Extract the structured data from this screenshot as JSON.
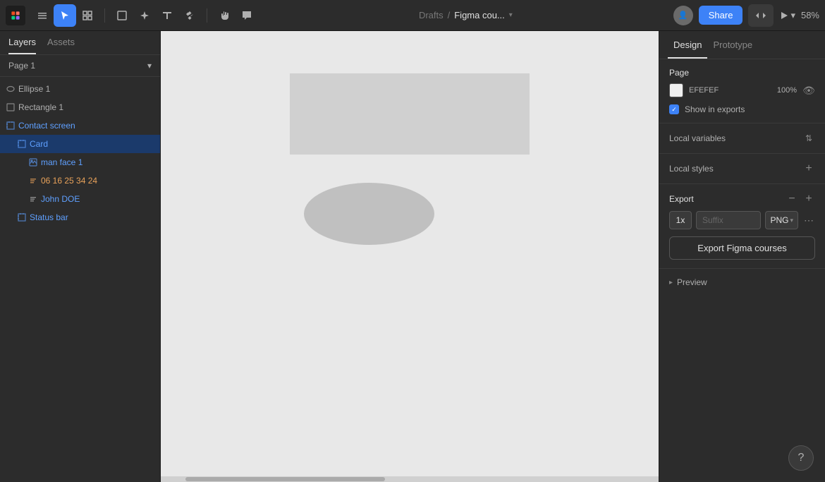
{
  "toolbar": {
    "logo_label": "Figma",
    "breadcrumb_prefix": "Drafts",
    "breadcrumb_separator": "/",
    "breadcrumb_title": "Figma cou...",
    "share_label": "Share",
    "zoom_label": "58%"
  },
  "left_panel": {
    "tab_layers": "Layers",
    "tab_assets": "Assets",
    "page_label": "Page 1",
    "layers": [
      {
        "id": "ellipse1",
        "label": "Ellipse 1",
        "type": "ellipse",
        "indent": 0
      },
      {
        "id": "rectangle1",
        "label": "Rectangle 1",
        "type": "rectangle",
        "indent": 0
      },
      {
        "id": "contact-screen",
        "label": "Contact screen",
        "type": "frame",
        "indent": 0,
        "selected": false
      },
      {
        "id": "card",
        "label": "Card",
        "type": "frame",
        "indent": 1,
        "selected": true
      },
      {
        "id": "man-face-1",
        "label": "man face 1",
        "type": "image",
        "indent": 2
      },
      {
        "id": "phone-number",
        "label": "06 16 25 34 24",
        "type": "text-orange",
        "indent": 2
      },
      {
        "id": "john-doe",
        "label": "John DOE",
        "type": "text-blue",
        "indent": 2
      },
      {
        "id": "status-bar",
        "label": "Status bar",
        "type": "frame",
        "indent": 1
      }
    ]
  },
  "right_panel": {
    "tab_design": "Design",
    "tab_prototype": "Prototype",
    "page_section_title": "Page",
    "page_color_value": "EFEFEF",
    "page_opacity_value": "100%",
    "show_in_exports_label": "Show in exports",
    "local_variables_label": "Local variables",
    "local_styles_label": "Local styles",
    "export_title": "Export",
    "export_scale": "1x",
    "export_suffix_placeholder": "Suffix",
    "export_format": "PNG",
    "export_btn_label": "Export Figma courses",
    "preview_label": "Preview"
  }
}
